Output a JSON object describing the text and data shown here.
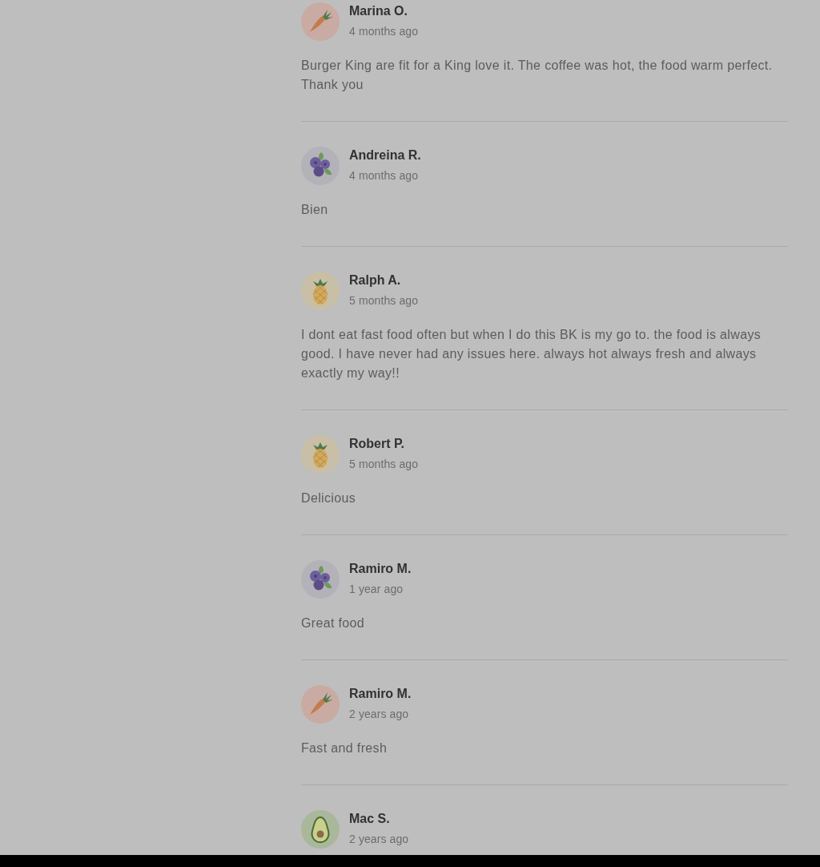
{
  "reviews": [
    {
      "author": "Marina O.",
      "time": "4 months ago",
      "text": "Burger King are fit for a King love it. The coffee was hot, the food warm perfect. Thank you",
      "avatar": {
        "kind": "carrot"
      }
    },
    {
      "author": "Andreina R.",
      "time": "4 months ago",
      "text": "Bien",
      "avatar": {
        "kind": "blueberries"
      }
    },
    {
      "author": "Ralph A.",
      "time": "5 months ago",
      "text": "I dont eat fast food often but when I do this BK is my go to. the food is always good. I have never had any issues here. always hot always fresh and always exactly my way!!",
      "avatar": {
        "kind": "pineapple"
      }
    },
    {
      "author": "Robert P.",
      "time": "5 months ago",
      "text": "Delicious",
      "avatar": {
        "kind": "pineapple"
      }
    },
    {
      "author": "Ramiro M.",
      "time": "1 year ago",
      "text": "Great food",
      "avatar": {
        "kind": "blueberries"
      }
    },
    {
      "author": "Ramiro M.",
      "time": "2 years ago",
      "text": "Fast and fresh",
      "avatar": {
        "kind": "carrot"
      }
    },
    {
      "author": "Mac S.",
      "time": "2 years ago",
      "avatar": {
        "kind": "avocado"
      }
    }
  ]
}
